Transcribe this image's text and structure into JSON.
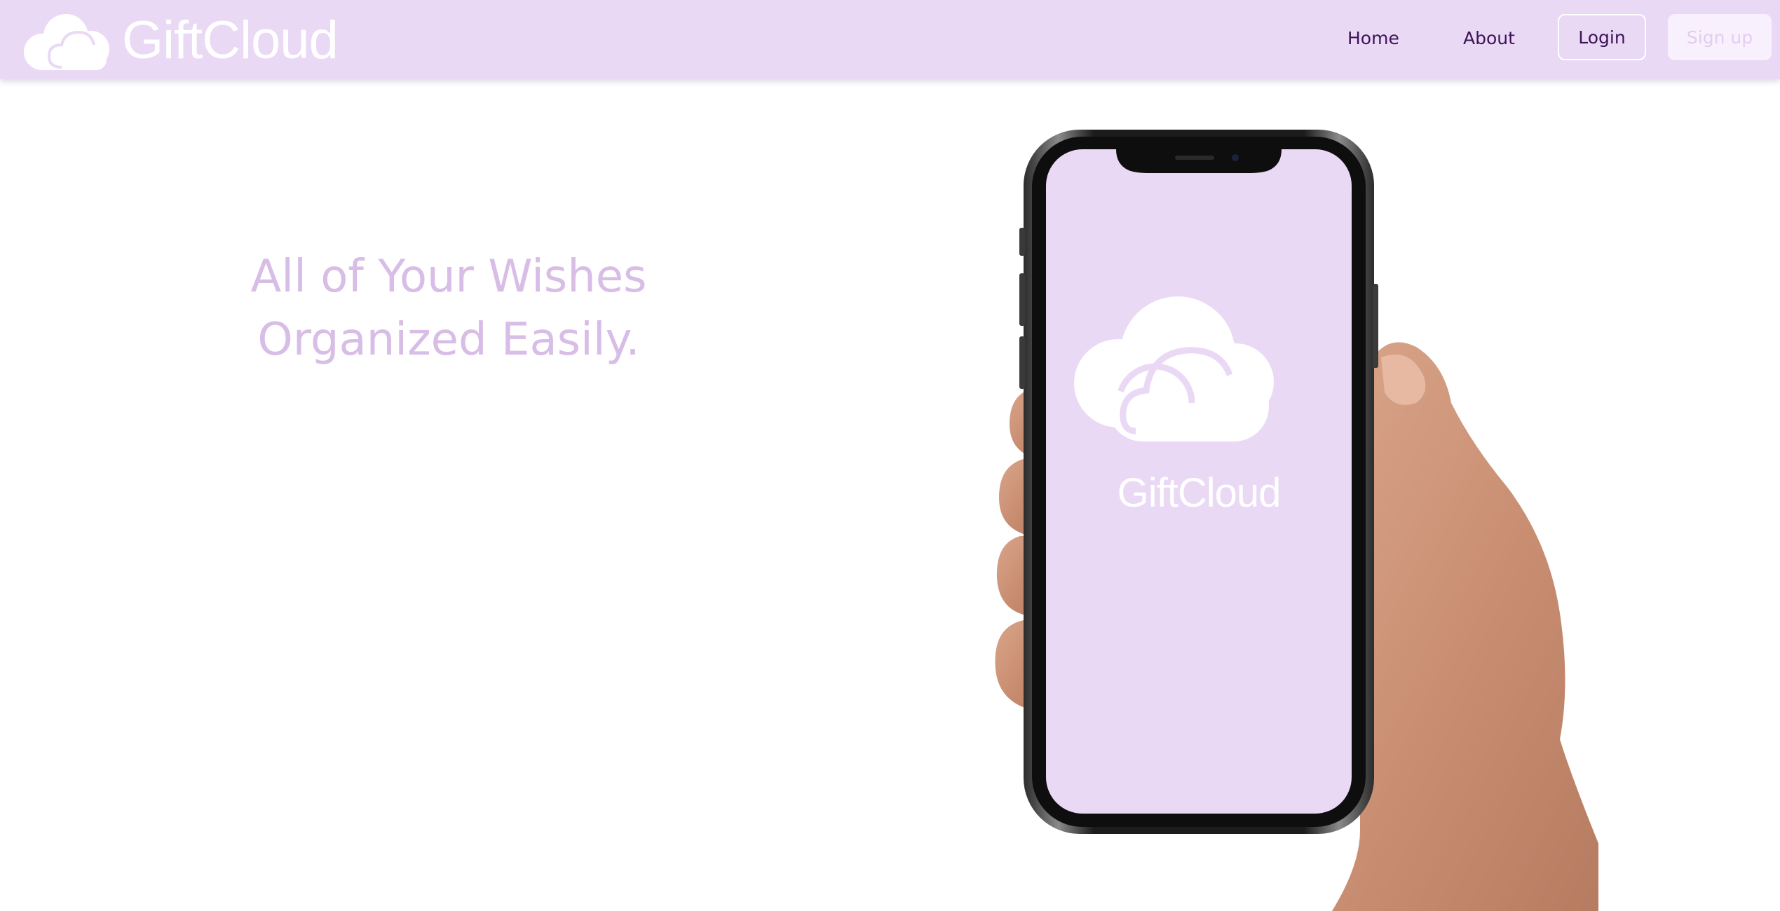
{
  "brand": {
    "name": "GiftCloud",
    "logo_icon": "cloud-icon"
  },
  "nav": {
    "home": "Home",
    "about": "About",
    "login": "Login",
    "signup": "Sign up"
  },
  "hero": {
    "line1": "All of Your Wishes",
    "line2": "Organized Easily.",
    "image": "hand-holding-phone-illustration",
    "phone_screen_logo": "GiftCloud"
  },
  "colors": {
    "navbar_bg": "#ead9f5",
    "nav_text": "#3d1457",
    "hero_text": "#d8bde6",
    "phone_screen": "#ead9f5",
    "signup_bg": "#f8f0fc"
  }
}
